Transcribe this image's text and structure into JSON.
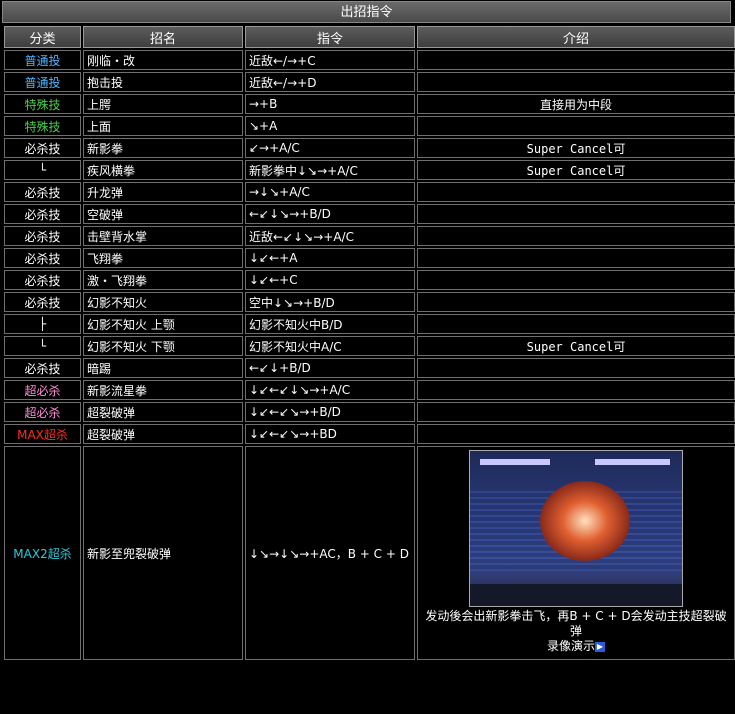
{
  "title": "出招指令",
  "headers": [
    "分类",
    "招名",
    "指令",
    "介绍"
  ],
  "rows": [
    {
      "cat": "普通投",
      "color": "#4fb4ff",
      "name": "刚临・改",
      "cmd": "近敌←/→+C",
      "note": ""
    },
    {
      "cat": "普通投",
      "color": "#4fb4ff",
      "name": "抱击投",
      "cmd": "近敌←/→+D",
      "note": ""
    },
    {
      "cat": "特殊技",
      "color": "#48d048",
      "name": "上腭",
      "cmd": "→+B",
      "note": "直接用为中段"
    },
    {
      "cat": "特殊技",
      "color": "#48d048",
      "name": "上面",
      "cmd": "↘+A",
      "note": ""
    },
    {
      "cat": "必杀技",
      "color": "#ffffff",
      "name": "新影拳",
      "cmd": "↙→+A/C",
      "note": "Super Cancel可"
    },
    {
      "cat": "└",
      "color": "#ffffff",
      "name": "疾风横拳",
      "cmd": "新影拳中↓↘→+A/C",
      "note": "Super Cancel可"
    },
    {
      "cat": "必杀技",
      "color": "#ffffff",
      "name": "升龙弹",
      "cmd": "→↓↘+A/C",
      "note": ""
    },
    {
      "cat": "必杀技",
      "color": "#ffffff",
      "name": "空破弹",
      "cmd": "←↙↓↘→+B/D",
      "note": ""
    },
    {
      "cat": "必杀技",
      "color": "#ffffff",
      "name": "击壁背水掌",
      "cmd": "近敌←↙↓↘→+A/C",
      "note": ""
    },
    {
      "cat": "必杀技",
      "color": "#ffffff",
      "name": "飞翔拳",
      "cmd": "↓↙←+A",
      "note": ""
    },
    {
      "cat": "必杀技",
      "color": "#ffffff",
      "name": "激・飞翔拳",
      "cmd": "↓↙←+C",
      "note": ""
    },
    {
      "cat": "必杀技",
      "color": "#ffffff",
      "name": "幻影不知火",
      "cmd": "空中↓↘→+B/D",
      "note": ""
    },
    {
      "cat": "├",
      "color": "#ffffff",
      "name": "幻影不知火 上颚",
      "cmd": "幻影不知火中B/D",
      "note": ""
    },
    {
      "cat": "└",
      "color": "#ffffff",
      "name": "幻影不知火 下颚",
      "cmd": "幻影不知火中A/C",
      "note": "Super Cancel可"
    },
    {
      "cat": "必杀技",
      "color": "#ffffff",
      "name": "暗踢",
      "cmd": "←↙↓+B/D",
      "note": ""
    },
    {
      "cat": "超必杀",
      "color": "#ff8fd8",
      "name": "新影流星拳",
      "cmd": "↓↙←↙↓↘→+A/C",
      "note": ""
    },
    {
      "cat": "超必杀",
      "color": "#ff8fd8",
      "name": "超裂破弹",
      "cmd": "↓↙←↙↘→+B/D",
      "note": ""
    },
    {
      "cat": "MAX超杀",
      "color": "#ff2a2a",
      "name": "超裂破弹",
      "cmd": "↓↙←↙↘→+BD",
      "note": ""
    }
  ],
  "last": {
    "cat": "MAX2超杀",
    "color": "#2fc8d8",
    "name": "新影至兜裂破弹",
    "cmd": "↓↘→↓↘→+AC，B + C + D",
    "caption": "发动後会出新影拳击飞，再B + C + D会发动主技超裂破弹",
    "replay": "录像演示"
  }
}
